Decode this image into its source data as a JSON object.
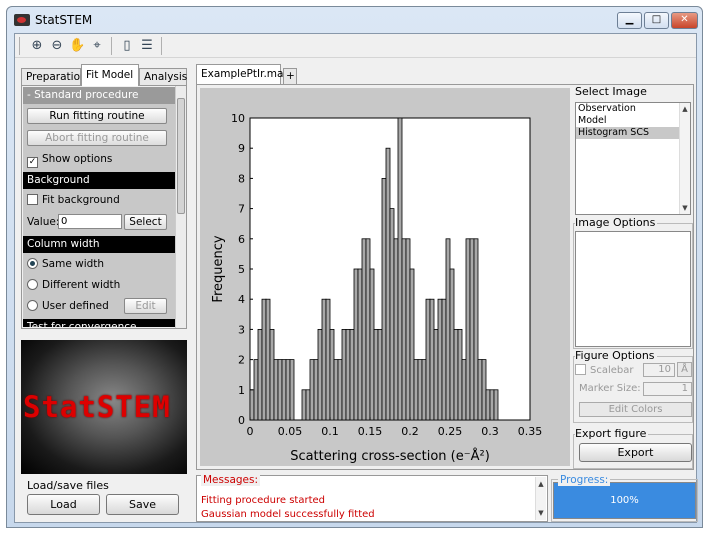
{
  "window": {
    "title": "StatSTEM",
    "min_label": "▁",
    "max_label": "□",
    "close_label": "✕"
  },
  "toolbar": {
    "icons": [
      "zoom-in-icon",
      "zoom-out-icon",
      "pan-hand-icon",
      "data-cursor-icon",
      "colorbar-icon",
      "legend-icon"
    ]
  },
  "left_tabs": [
    "Preparation",
    "Fit Model",
    "Analysis"
  ],
  "fit_model": {
    "standard_header": "- Standard procedure",
    "run_button": "Run fitting routine",
    "abort_button": "Abort fitting routine",
    "show_options": "Show options",
    "show_options_checked": true,
    "background_header": "Background",
    "fit_background": "Fit background",
    "value_label": "Value:",
    "value": "0",
    "select_button": "Select",
    "column_width_header": "Column width",
    "same_width": "Same width",
    "different_width": "Different width",
    "user_defined": "User defined",
    "edit_button": "Edit",
    "test_convergence": "Test for convergence"
  },
  "logo": {
    "text": "StatSTEM"
  },
  "load_save": {
    "label": "Load/save files",
    "load_button": "Load",
    "save_button": "Save"
  },
  "figure_tabs": [
    "ExamplePtIr.mat",
    "+"
  ],
  "select_image": {
    "label": "Select Image",
    "items": [
      "Observation",
      "Model",
      "Histogram SCS"
    ],
    "selected_index": 2
  },
  "image_options": {
    "label": "Image Options"
  },
  "figure_options": {
    "label": "Figure Options",
    "scalebar_label": "Scalebar",
    "scalebar_value": "10",
    "scalebar_unit": "Å",
    "marker_size_label": "Marker Size:",
    "marker_size_value": "1",
    "edit_colors_button": "Edit Colors"
  },
  "export": {
    "label": "Export figure",
    "button": "Export"
  },
  "messages": {
    "label": "Messages:",
    "lines": [
      "Fitting procedure started",
      "Gaussian model successfully fitted"
    ]
  },
  "progress": {
    "label": "Progress:",
    "value": "100%",
    "fraction": 1.0
  },
  "colors": {
    "accent_blue": "#3a8be0",
    "message_red": "#cc0000",
    "bar_fill": "#a8a8a8"
  },
  "chart_data": {
    "type": "bar",
    "xlabel": "Scattering cross-section (e⁻Å²)",
    "ylabel": "Frequency",
    "xlim": [
      0,
      0.35
    ],
    "ylim": [
      0,
      10
    ],
    "xticks": [
      "0",
      "0.05",
      "0.1",
      "0.15",
      "0.2",
      "0.25",
      "0.3",
      "0.35"
    ],
    "yticks": [
      "0",
      "1",
      "2",
      "3",
      "4",
      "5",
      "6",
      "7",
      "8",
      "9",
      "10"
    ],
    "bin_width": 0.005,
    "bin_starts": [
      0.0,
      0.005,
      0.01,
      0.015,
      0.02,
      0.025,
      0.03,
      0.035,
      0.04,
      0.045,
      0.05,
      0.055,
      0.06,
      0.065,
      0.07,
      0.075,
      0.08,
      0.085,
      0.09,
      0.095,
      0.1,
      0.105,
      0.11,
      0.115,
      0.12,
      0.125,
      0.13,
      0.135,
      0.14,
      0.145,
      0.15,
      0.155,
      0.16,
      0.165,
      0.17,
      0.175,
      0.18,
      0.185,
      0.19,
      0.195,
      0.2,
      0.205,
      0.21,
      0.215,
      0.22,
      0.225,
      0.23,
      0.235,
      0.24,
      0.245,
      0.25,
      0.255,
      0.26,
      0.265,
      0.27,
      0.275,
      0.28,
      0.285,
      0.29,
      0.295,
      0.3,
      0.305
    ],
    "values": [
      1,
      2,
      3,
      4,
      4,
      3,
      2,
      2,
      2,
      2,
      2,
      0,
      0,
      1,
      1,
      2,
      2,
      3,
      4,
      4,
      3,
      2,
      2,
      3,
      3,
      3,
      5,
      5,
      6,
      6,
      5,
      3,
      3,
      8,
      9,
      7,
      6,
      10,
      6,
      6,
      5,
      2,
      2,
      2,
      4,
      4,
      3,
      4,
      4,
      6,
      5,
      3,
      3,
      2,
      6,
      6,
      6,
      2,
      2,
      1,
      1,
      1
    ]
  }
}
